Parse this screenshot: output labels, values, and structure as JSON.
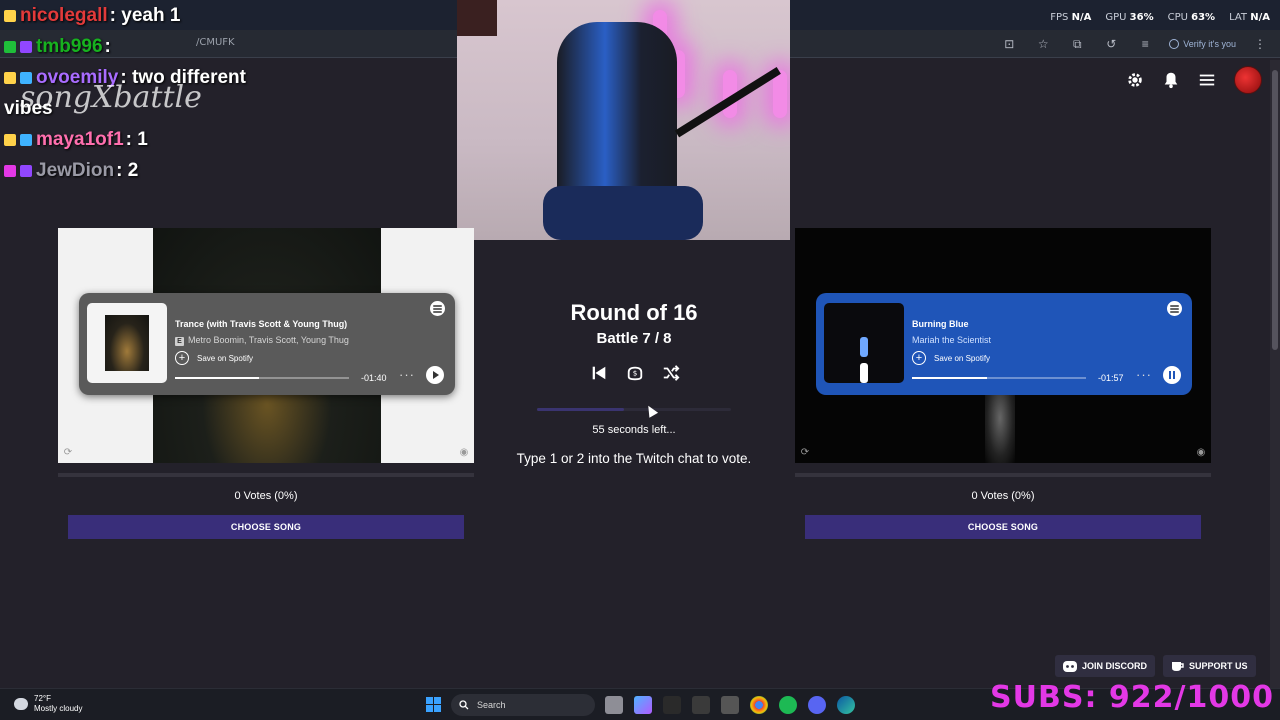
{
  "browser": {
    "url": "/CMUFK",
    "verify_label": "Verify it's you"
  },
  "perf": {
    "fps_label": "FPS",
    "fps": "N/A",
    "gpu_label": "GPU",
    "gpu": "36%",
    "cpu_label": "CPU",
    "cpu": "63%",
    "lat_label": "LAT",
    "lat": "N/A"
  },
  "chat": [
    {
      "user": "nicolegall",
      "msg": ": yeah 1",
      "color": "#e33a3a"
    },
    {
      "user": "tmb996",
      "msg": ":",
      "color": "#17b21f"
    },
    {
      "user": "ovoemily",
      "msg": ": two different",
      "color": "#a96cff"
    },
    {
      "user": "",
      "msg": "vibes",
      "color": "#ffffff"
    },
    {
      "user": "maya1of1",
      "msg": ": 1",
      "color": "#ff6fae"
    },
    {
      "user": "JewDion",
      "msg": ": 2",
      "color": "#9a9aa6"
    }
  ],
  "watermark": "songXbattle",
  "round": {
    "title": "Round of 16",
    "battle": "Battle 7 / 8",
    "seconds_left": "55 seconds left...",
    "instructions": "Type 1 or 2 into the Twitch chat to vote.",
    "timer_fraction": 0.45
  },
  "songs": [
    {
      "title": "Trance (with Travis Scott & Young Thug)",
      "explicit": "E",
      "artist": "Metro Boomin, Travis Scott, Young Thug",
      "save_label": "Save on Spotify",
      "time_left": "-01:40",
      "progress": 0.48,
      "votes": "0 Votes (0%)",
      "button": "CHOOSE SONG"
    },
    {
      "title": "Burning Blue",
      "artist": "Mariah the Scientist",
      "save_label": "Save on Spotify",
      "time_left": "-01:57",
      "progress": 0.43,
      "votes": "0 Votes (0%)",
      "button": "CHOOSE SONG"
    }
  ],
  "footer": {
    "discord": "JOIN DISCORD",
    "support": "SUPPORT US"
  },
  "subs": "SUBS: 922/1000",
  "taskbar": {
    "temp": "72°F",
    "weather": "Mostly cloudy",
    "search": "Search"
  },
  "colors": {
    "accent": "#392e7a",
    "spotify_blue": "#1f55b8",
    "subs_pink": "#e338e6"
  }
}
